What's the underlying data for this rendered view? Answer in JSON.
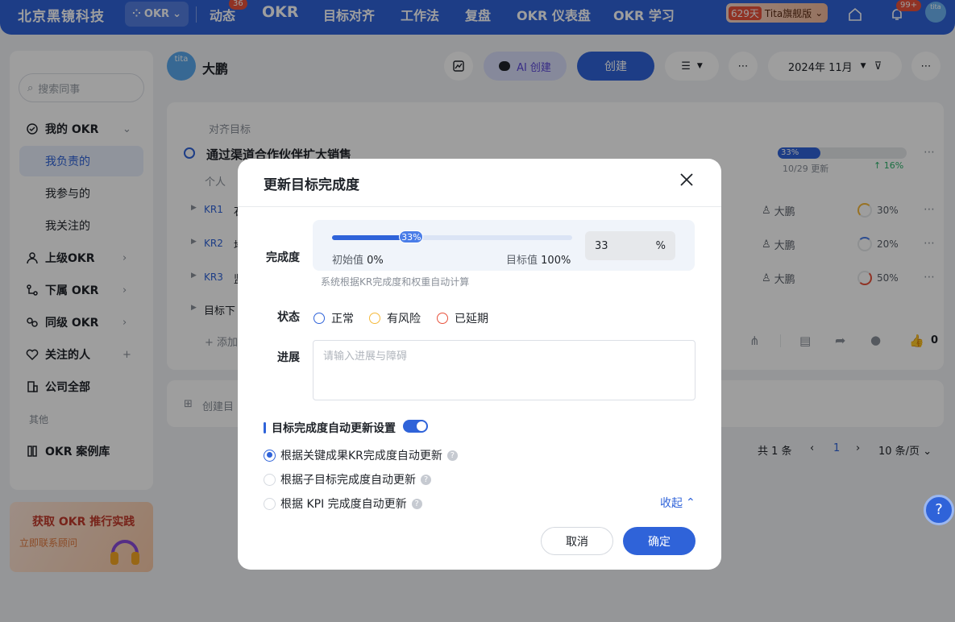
{
  "topbar": {
    "brand": "北京黑镜科技",
    "okr_switch": "OKR",
    "nav": [
      "动态",
      "OKR",
      "目标对齐",
      "工作法",
      "复盘",
      "OKR 仪表盘",
      "OKR 学习"
    ],
    "nav_badge": "36",
    "vip_days": "629天",
    "vip_label": "Tita旗舰版",
    "bell_badge": "99+",
    "avatar_text": "tita"
  },
  "sidebar": {
    "search_placeholder": "搜索同事",
    "my_okr": "我的 OKR",
    "sub_items": [
      "我负责的",
      "我参与的",
      "我关注的"
    ],
    "items": [
      "上级OKR",
      "下属 OKR",
      "同级 OKR",
      "关注的人",
      "公司全部"
    ],
    "other_label": "其他",
    "case_library": "OKR 案例库",
    "promo_title": "获取 OKR 推行实践",
    "promo_sub": "立即联系顾问"
  },
  "header": {
    "avatar_text": "tita",
    "user_name": "大鹏",
    "ai_create": "AI 创建",
    "create": "创建",
    "period": "2024年 11月"
  },
  "objective": {
    "align_label": "对齐目标",
    "title": "通过渠道合作伙伴扩大销售",
    "progress_label": "33%",
    "progress_value": 33,
    "update_date": "10/29 更新",
    "trend": "↑ 16%",
    "owner_prefix": "个人",
    "krs": [
      {
        "code": "KR1",
        "lead": "石",
        "owner": "大鹏",
        "pct": "30%",
        "color": "#f5b93b"
      },
      {
        "code": "KR2",
        "lead": "地",
        "owner": "大鹏",
        "pct": "20%",
        "color": "#4a7de8"
      },
      {
        "code": "KR3",
        "lead": "监",
        "owner": "大鹏",
        "pct": "50%",
        "color": "#e8513b"
      }
    ],
    "sub_goal": "目标下",
    "add_label": "添加",
    "like_count": "0",
    "create_goal": "创建目"
  },
  "pager": {
    "total": "共 1 条",
    "page": "1",
    "per_page": "10 条/页"
  },
  "modal": {
    "title": "更新目标完成度",
    "completion_label": "完成度",
    "progress_value": 33,
    "knob_label": "33%",
    "initial_label": "初始值",
    "initial_value": "0%",
    "target_label": "目标值",
    "target_value": "100%",
    "input_value": "33",
    "input_unit": "%",
    "auto_note": "系统根据KR完成度和权重自动计算",
    "status_label": "状态",
    "status_options": [
      {
        "label": "正常",
        "color": "#2f63d9"
      },
      {
        "label": "有风险",
        "color": "#f5b93b"
      },
      {
        "label": "已延期",
        "color": "#e8513b"
      }
    ],
    "progress_label": "进展",
    "progress_placeholder": "请输入进展与障碍",
    "auto_section_title": "目标完成度自动更新设置",
    "auto_options": [
      "根据关键成果KR完成度自动更新",
      "根据子目标完成度自动更新",
      "根据 KPI 完成度自动更新"
    ],
    "collapse": "收起",
    "cancel": "取消",
    "confirm": "确定"
  },
  "help": "?"
}
